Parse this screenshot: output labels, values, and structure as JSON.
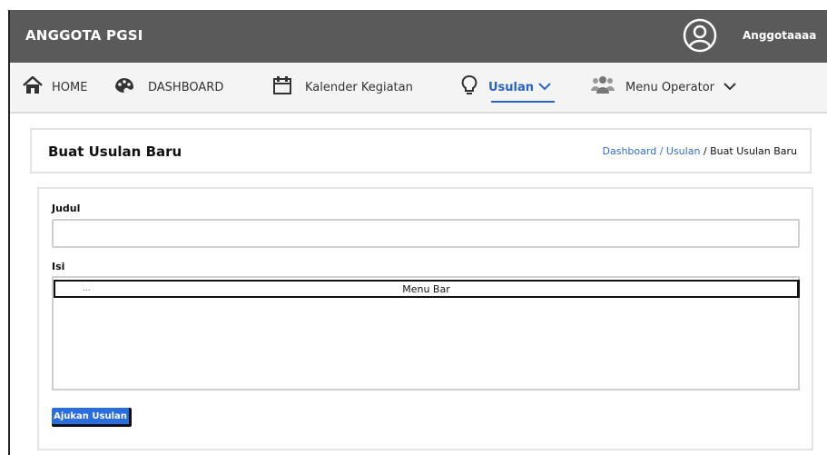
{
  "app": {
    "brand": "ANGGOTA PGSI",
    "username": "Anggotaaaa"
  },
  "nav": {
    "items": [
      {
        "label": "HOME",
        "icon": "home-icon"
      },
      {
        "label": "DASHBOARD",
        "icon": "palette-icon"
      },
      {
        "label": "Kalender Kegiatan",
        "icon": "calendar-icon"
      },
      {
        "label": "Usulan",
        "icon": "lightbulb-icon",
        "active": true
      },
      {
        "label": "Menu Operator",
        "icon": "users-icon"
      }
    ]
  },
  "page": {
    "title": "Buat Usulan Baru",
    "breadcrumb": {
      "link": "Dashboard / Usulan",
      "separator": " / ",
      "current": "Buat Usulan Baru"
    }
  },
  "form": {
    "judul_label": "Judul",
    "judul_value": "",
    "isi_label": "Isi",
    "editor_menu_dots": "...",
    "editor_menu_title": "Menu Bar",
    "submit_label": "Ajukan Usulan"
  },
  "colors": {
    "topbar": "#5a5a5a",
    "accent": "#2864c8",
    "button": "#2a6de0"
  }
}
